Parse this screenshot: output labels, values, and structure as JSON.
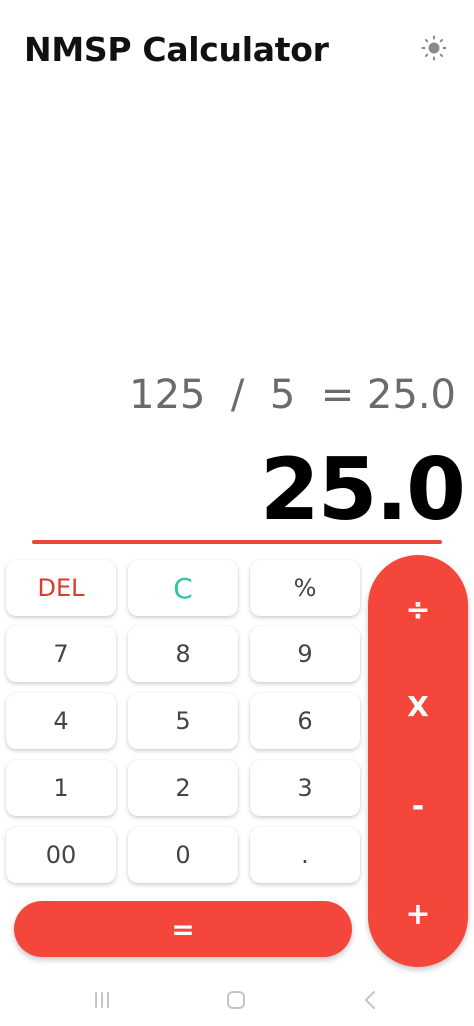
{
  "app": {
    "title": "NMSP Calculator",
    "accent_color": "#f4463a",
    "theme_icon": "sun-icon"
  },
  "display": {
    "expression": "125  /  5  = 25.0",
    "result": "25.0"
  },
  "keys": {
    "del": "DEL",
    "clear": "C",
    "percent": "%",
    "seven": "7",
    "eight": "8",
    "nine": "9",
    "four": "4",
    "five": "5",
    "six": "6",
    "one": "1",
    "two": "2",
    "three": "3",
    "double_zero": "00",
    "zero": "0",
    "dot": ".",
    "equals": "="
  },
  "operators": {
    "divide": "÷",
    "multiply": "X",
    "subtract": "-",
    "add": "+"
  },
  "navigation": {
    "recent_icon": "recent-apps-icon",
    "home_icon": "home-icon",
    "back_icon": "back-icon"
  }
}
